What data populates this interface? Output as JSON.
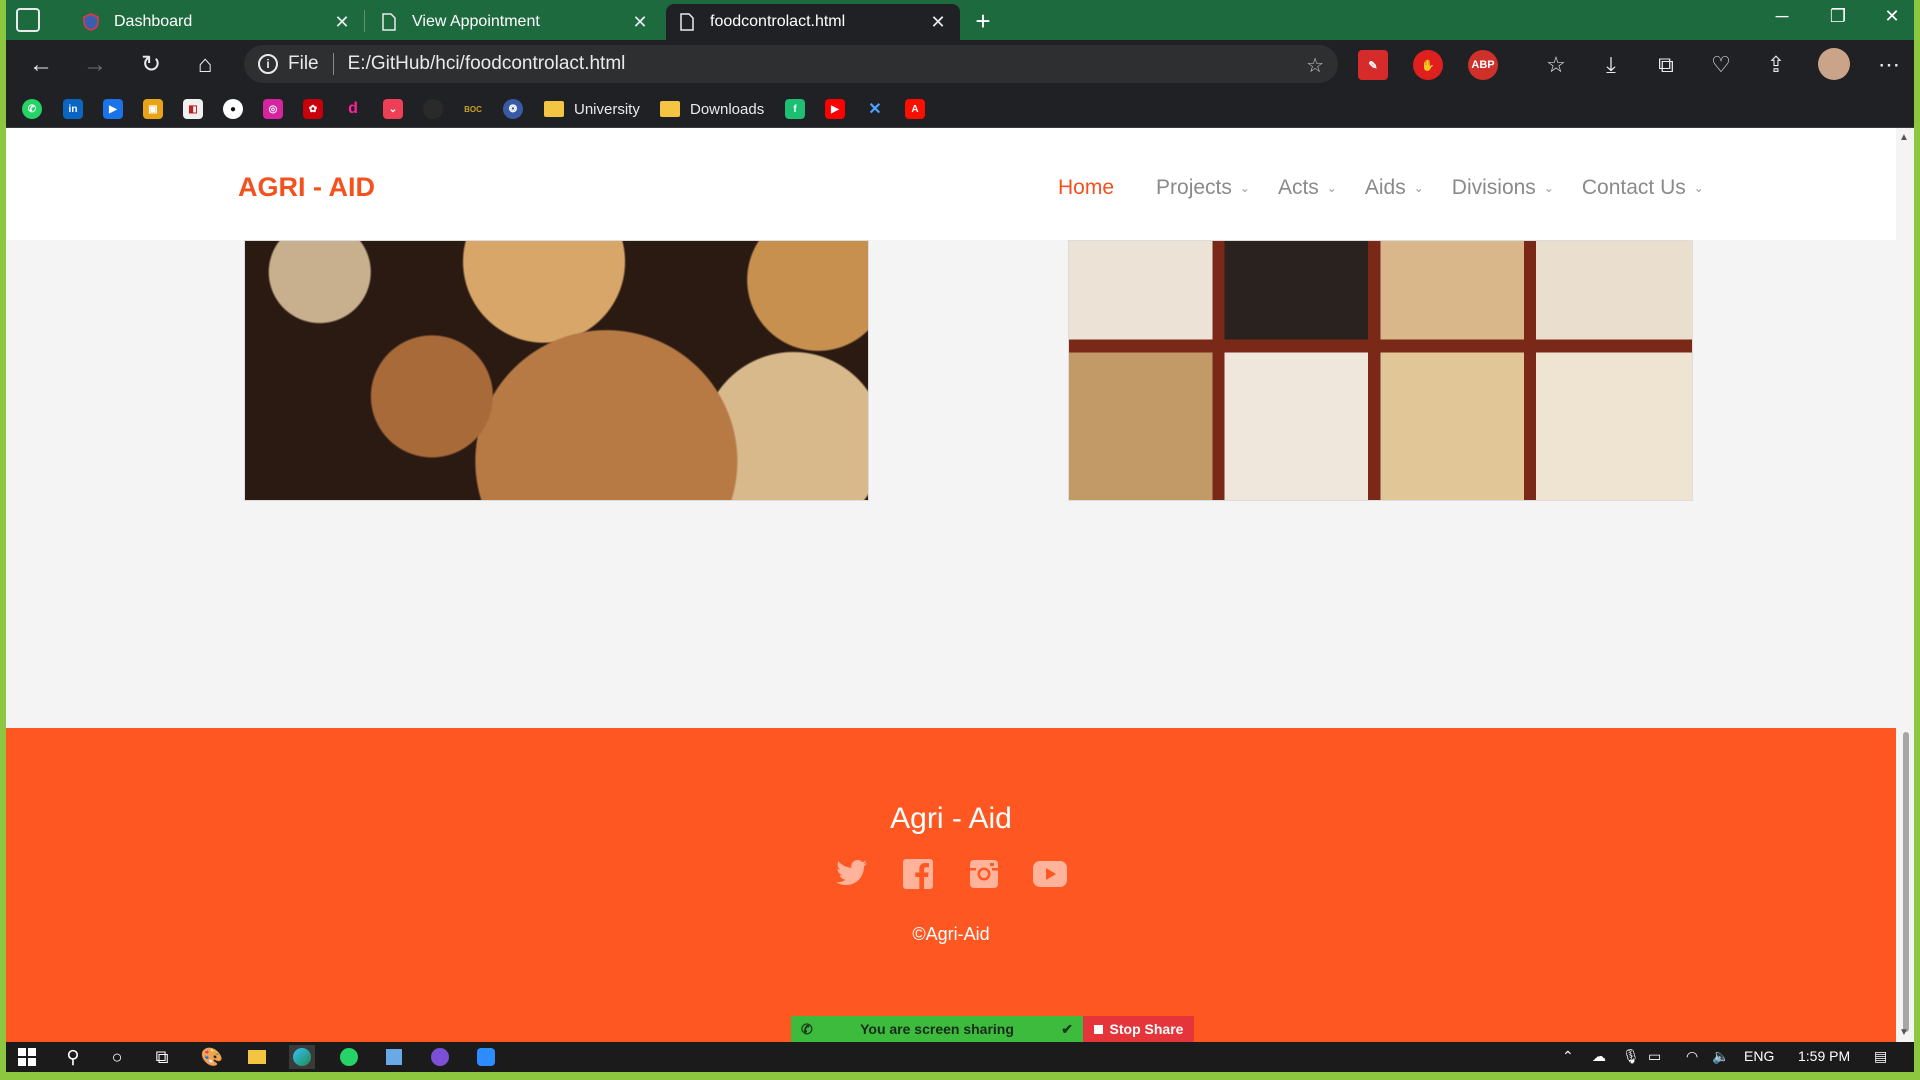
{
  "browser": {
    "tabs": [
      {
        "label": "Dashboard",
        "icon": "shield-icon"
      },
      {
        "label": "View Appointment",
        "icon": "page-icon"
      },
      {
        "label": "foodcontrolact.html",
        "icon": "page-icon"
      }
    ],
    "address": {
      "scheme_label": "File",
      "url": "E:/GitHub/hci/foodcontrolact.html"
    },
    "extension_abp": "ABP",
    "bookmarks": [
      {
        "label": "University"
      },
      {
        "label": "Downloads"
      }
    ]
  },
  "site": {
    "brand": "AGRI - AID",
    "nav": [
      {
        "label": "Home"
      },
      {
        "label": "Projects"
      },
      {
        "label": "Acts"
      },
      {
        "label": "Aids"
      },
      {
        "label": "Divisions"
      },
      {
        "label": "Contact Us"
      }
    ],
    "footer": {
      "title": "Agri - Aid",
      "social": [
        "twitter-icon",
        "facebook-icon",
        "instagram-icon",
        "youtube-icon"
      ],
      "copyright": "©Agri-Aid"
    }
  },
  "screen_share": {
    "status": "You are screen sharing",
    "stop_label": "Stop Share"
  },
  "taskbar": {
    "lang": "ENG",
    "time": "1:59 PM"
  },
  "colors": {
    "accent": "#ff5722",
    "tabbar": "#1e6a3f",
    "frame": "#8dc63f"
  }
}
